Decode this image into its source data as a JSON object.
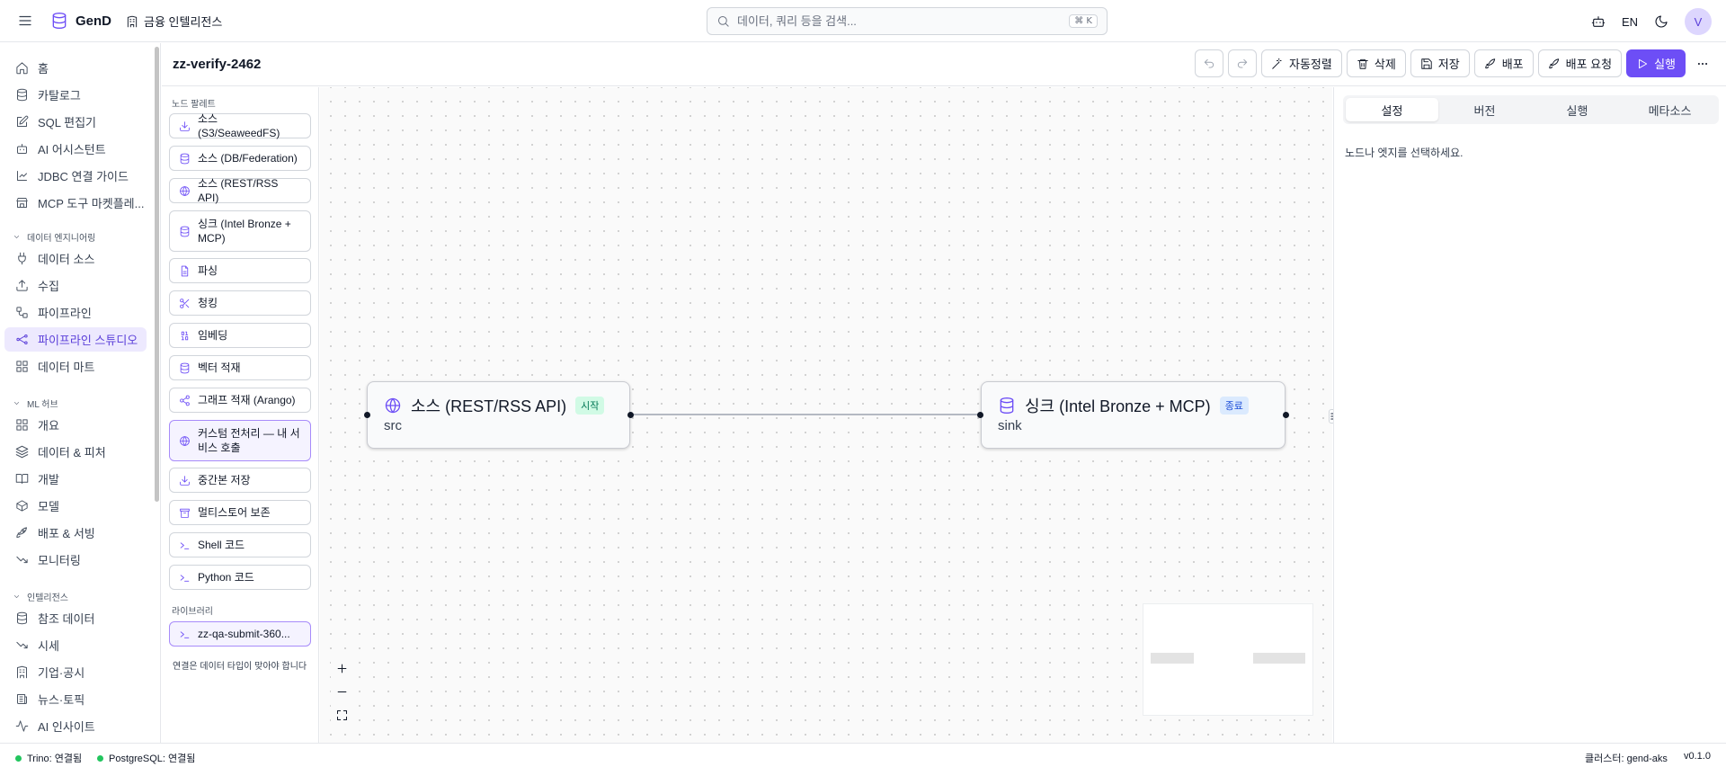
{
  "app": {
    "name": "GenD",
    "workspace": "금융 인텔리전스",
    "lang": "EN",
    "avatar_initial": "V"
  },
  "search": {
    "placeholder": "데이터, 쿼리 등을 검색...",
    "shortcut": "⌘ K"
  },
  "sidebar": {
    "items_top": [
      {
        "label": "홈",
        "icon": "home-icon"
      },
      {
        "label": "카탈로그",
        "icon": "database-icon"
      },
      {
        "label": "SQL 편집기",
        "icon": "edit-icon"
      },
      {
        "label": "AI 어시스턴트",
        "icon": "bot-icon"
      },
      {
        "label": "JDBC 연결 가이드",
        "icon": "plug-guide-icon"
      },
      {
        "label": "MCP 도구 마켓플레...",
        "icon": "store-icon"
      }
    ],
    "section_data_eng": "데이터 엔지니어링",
    "items_data_eng": [
      {
        "label": "데이터 소스",
        "icon": "plug-icon"
      },
      {
        "label": "수집",
        "icon": "upload-icon"
      },
      {
        "label": "파이프라인",
        "icon": "workflow-icon"
      },
      {
        "label": "파이프라인 스튜디오",
        "icon": "waypoints-icon",
        "active": true
      },
      {
        "label": "데이터 마트",
        "icon": "grid-icon"
      }
    ],
    "section_ml": "ML 허브",
    "items_ml": [
      {
        "label": "개요",
        "icon": "grid-icon"
      },
      {
        "label": "데이터 & 피처",
        "icon": "layers-icon"
      },
      {
        "label": "개발",
        "icon": "book-icon"
      },
      {
        "label": "모델",
        "icon": "box-icon"
      },
      {
        "label": "배포 & 서빙",
        "icon": "rocket-icon"
      },
      {
        "label": "모니터링",
        "icon": "trending-down-icon"
      }
    ],
    "section_intel": "인텔리전스",
    "items_intel": [
      {
        "label": "참조 데이터",
        "icon": "database-icon"
      },
      {
        "label": "시세",
        "icon": "trending-down-icon"
      },
      {
        "label": "기업·공시",
        "icon": "building-icon"
      },
      {
        "label": "뉴스·토픽",
        "icon": "newspaper-icon"
      },
      {
        "label": "AI 인사이트",
        "icon": "activity-icon"
      }
    ]
  },
  "pipeline": {
    "title": "zz-verify-2462"
  },
  "toolbar": {
    "autolayout": "자동정렬",
    "delete": "삭제",
    "save": "저장",
    "deploy": "배포",
    "deploy_request": "배포 요청",
    "run": "실행"
  },
  "palette": {
    "heading": "노드 팔레트",
    "items": [
      {
        "label": "소스 (S3/SeaweedFS)",
        "icon": "download-icon"
      },
      {
        "label": "소스 (DB/Federation)",
        "icon": "database-icon"
      },
      {
        "label": "소스 (REST/RSS API)",
        "icon": "globe-icon"
      },
      {
        "label": "싱크 (Intel Bronze + MCP)",
        "icon": "database-icon"
      },
      {
        "label": "파싱",
        "icon": "file-icon"
      },
      {
        "label": "청킹",
        "icon": "scissors-icon"
      },
      {
        "label": "임베딩",
        "icon": "binary-icon"
      },
      {
        "label": "벡터 적재",
        "icon": "database-icon"
      },
      {
        "label": "그래프 적재 (Arango)",
        "icon": "share-icon"
      },
      {
        "label": "커스텀 전처리 — 내 서비스 호출",
        "icon": "globe-icon"
      },
      {
        "label": "중간본 저장",
        "icon": "download-icon"
      },
      {
        "label": "멀티스토어 보존",
        "icon": "archive-icon"
      },
      {
        "label": "Shell 코드",
        "icon": "terminal-icon"
      },
      {
        "label": "Python 코드",
        "icon": "terminal-icon"
      }
    ],
    "library_heading": "라이브러리",
    "library_items": [
      {
        "label": "zz-qa-submit-360...",
        "icon": "terminal-icon"
      }
    ],
    "hint": "연결은 데이터 타입이 맞아야 합니다"
  },
  "canvas": {
    "nodes": [
      {
        "title": "소스 (REST/RSS API)",
        "badge": "시작",
        "subtitle": "src",
        "icon": "globe-icon"
      },
      {
        "title": "싱크 (Intel Bronze + MCP)",
        "badge": "종료",
        "subtitle": "sink",
        "icon": "database-icon"
      }
    ]
  },
  "panel": {
    "tabs": [
      "설정",
      "버전",
      "실행",
      "메타소스"
    ],
    "active_tab": "설정",
    "empty_message": "노드나 엣지를 선택하세요."
  },
  "status": {
    "trino": "Trino: 연결됨",
    "postgres": "PostgreSQL: 연결됨",
    "cluster": "클러스터: gend-aks",
    "version": "v0.1.0"
  },
  "colors": {
    "accent": "#6d4ef6",
    "connected": "#22c55e",
    "start_badge": "#d1fae5",
    "end_badge": "#dbeafe"
  }
}
